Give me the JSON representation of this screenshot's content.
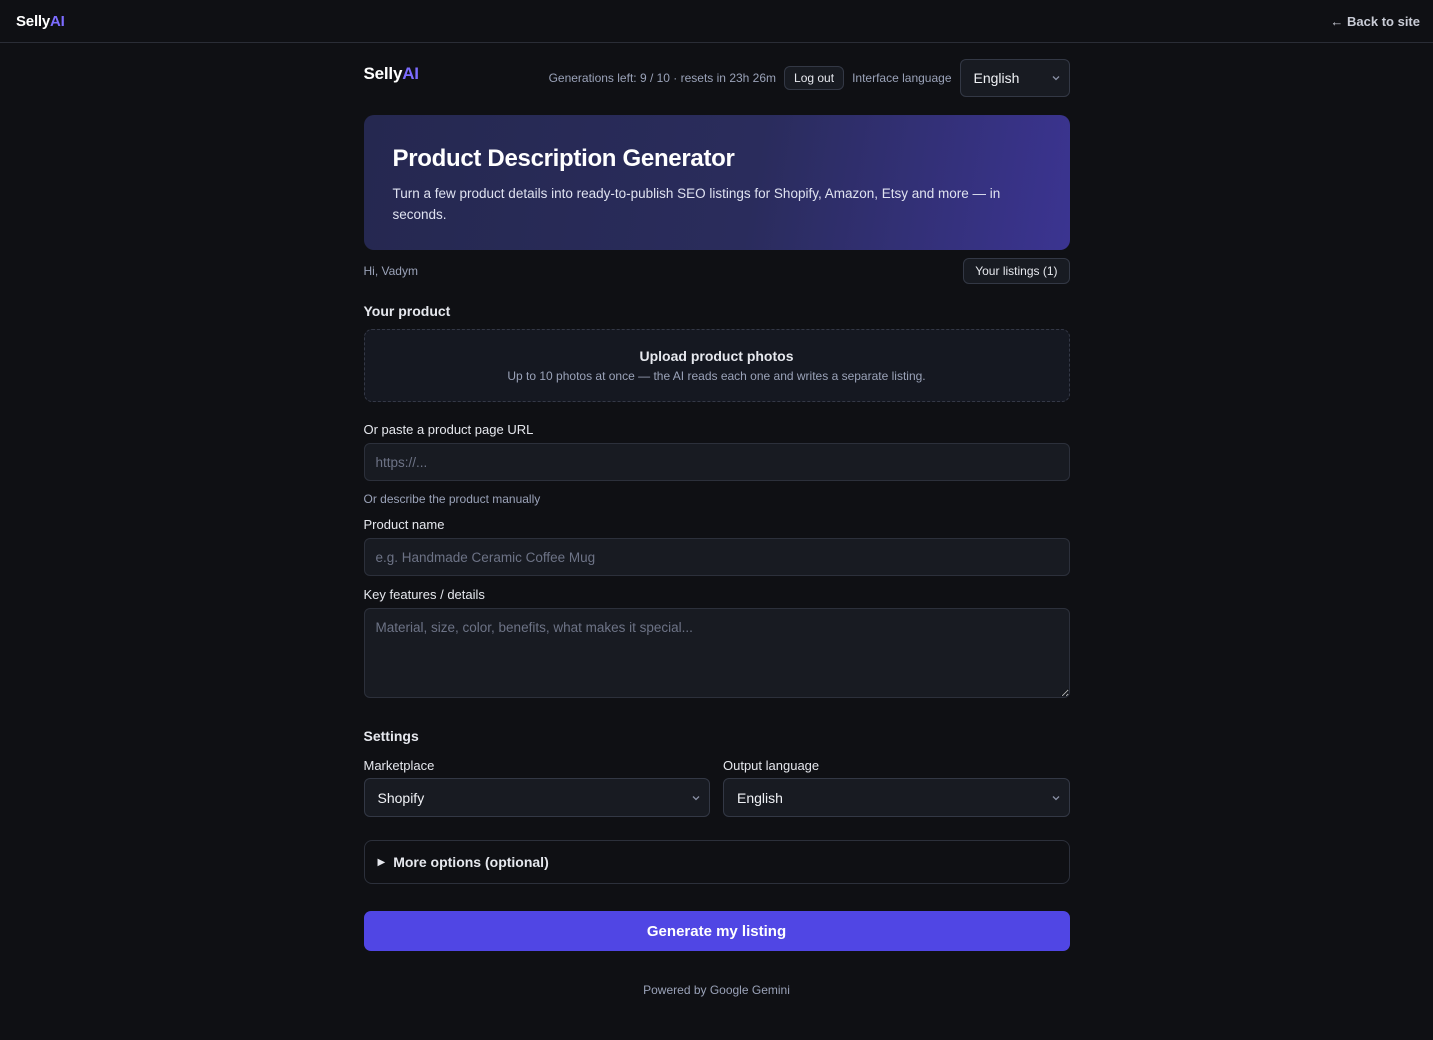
{
  "topbar": {
    "logo_main": "Selly",
    "logo_ai": "AI",
    "back_link": "← Back to site"
  },
  "header": {
    "logo_main": "Selly",
    "logo_ai": "AI",
    "generations_text": "Generations left: 9 / 10 · resets in 23h 26m",
    "logout_label": "Log out",
    "interface_language_label": "Interface language",
    "interface_language_value": "English"
  },
  "hero": {
    "title": "Product Description Generator",
    "subtitle": "Turn a few product details into ready-to-publish SEO listings for Shopify, Amazon, Etsy and more — in seconds."
  },
  "user": {
    "greeting": "Hi, Vadym",
    "listings_button": "Your listings (1)"
  },
  "product": {
    "section_title": "Your product",
    "upload_title": "Upload product photos",
    "upload_subtitle": "Up to 10 photos at once — the AI reads each one and writes a separate listing.",
    "url_label": "Or paste a product page URL",
    "url_placeholder": "https://...",
    "manual_hint": "Or describe the product manually",
    "name_label": "Product name",
    "name_placeholder": "e.g. Handmade Ceramic Coffee Mug",
    "features_label": "Key features / details",
    "features_placeholder": "Material, size, color, benefits, what makes it special..."
  },
  "settings": {
    "section_title": "Settings",
    "marketplace_label": "Marketplace",
    "marketplace_value": "Shopify",
    "output_language_label": "Output language",
    "output_language_value": "English",
    "more_options_label": "More options (optional)"
  },
  "actions": {
    "generate_label": "Generate my listing"
  },
  "footer": {
    "text": "Powered by Google Gemini"
  },
  "colors": {
    "background": "#0f1014",
    "accent": "#5046e4",
    "logo_ai": "#7c6cff"
  }
}
